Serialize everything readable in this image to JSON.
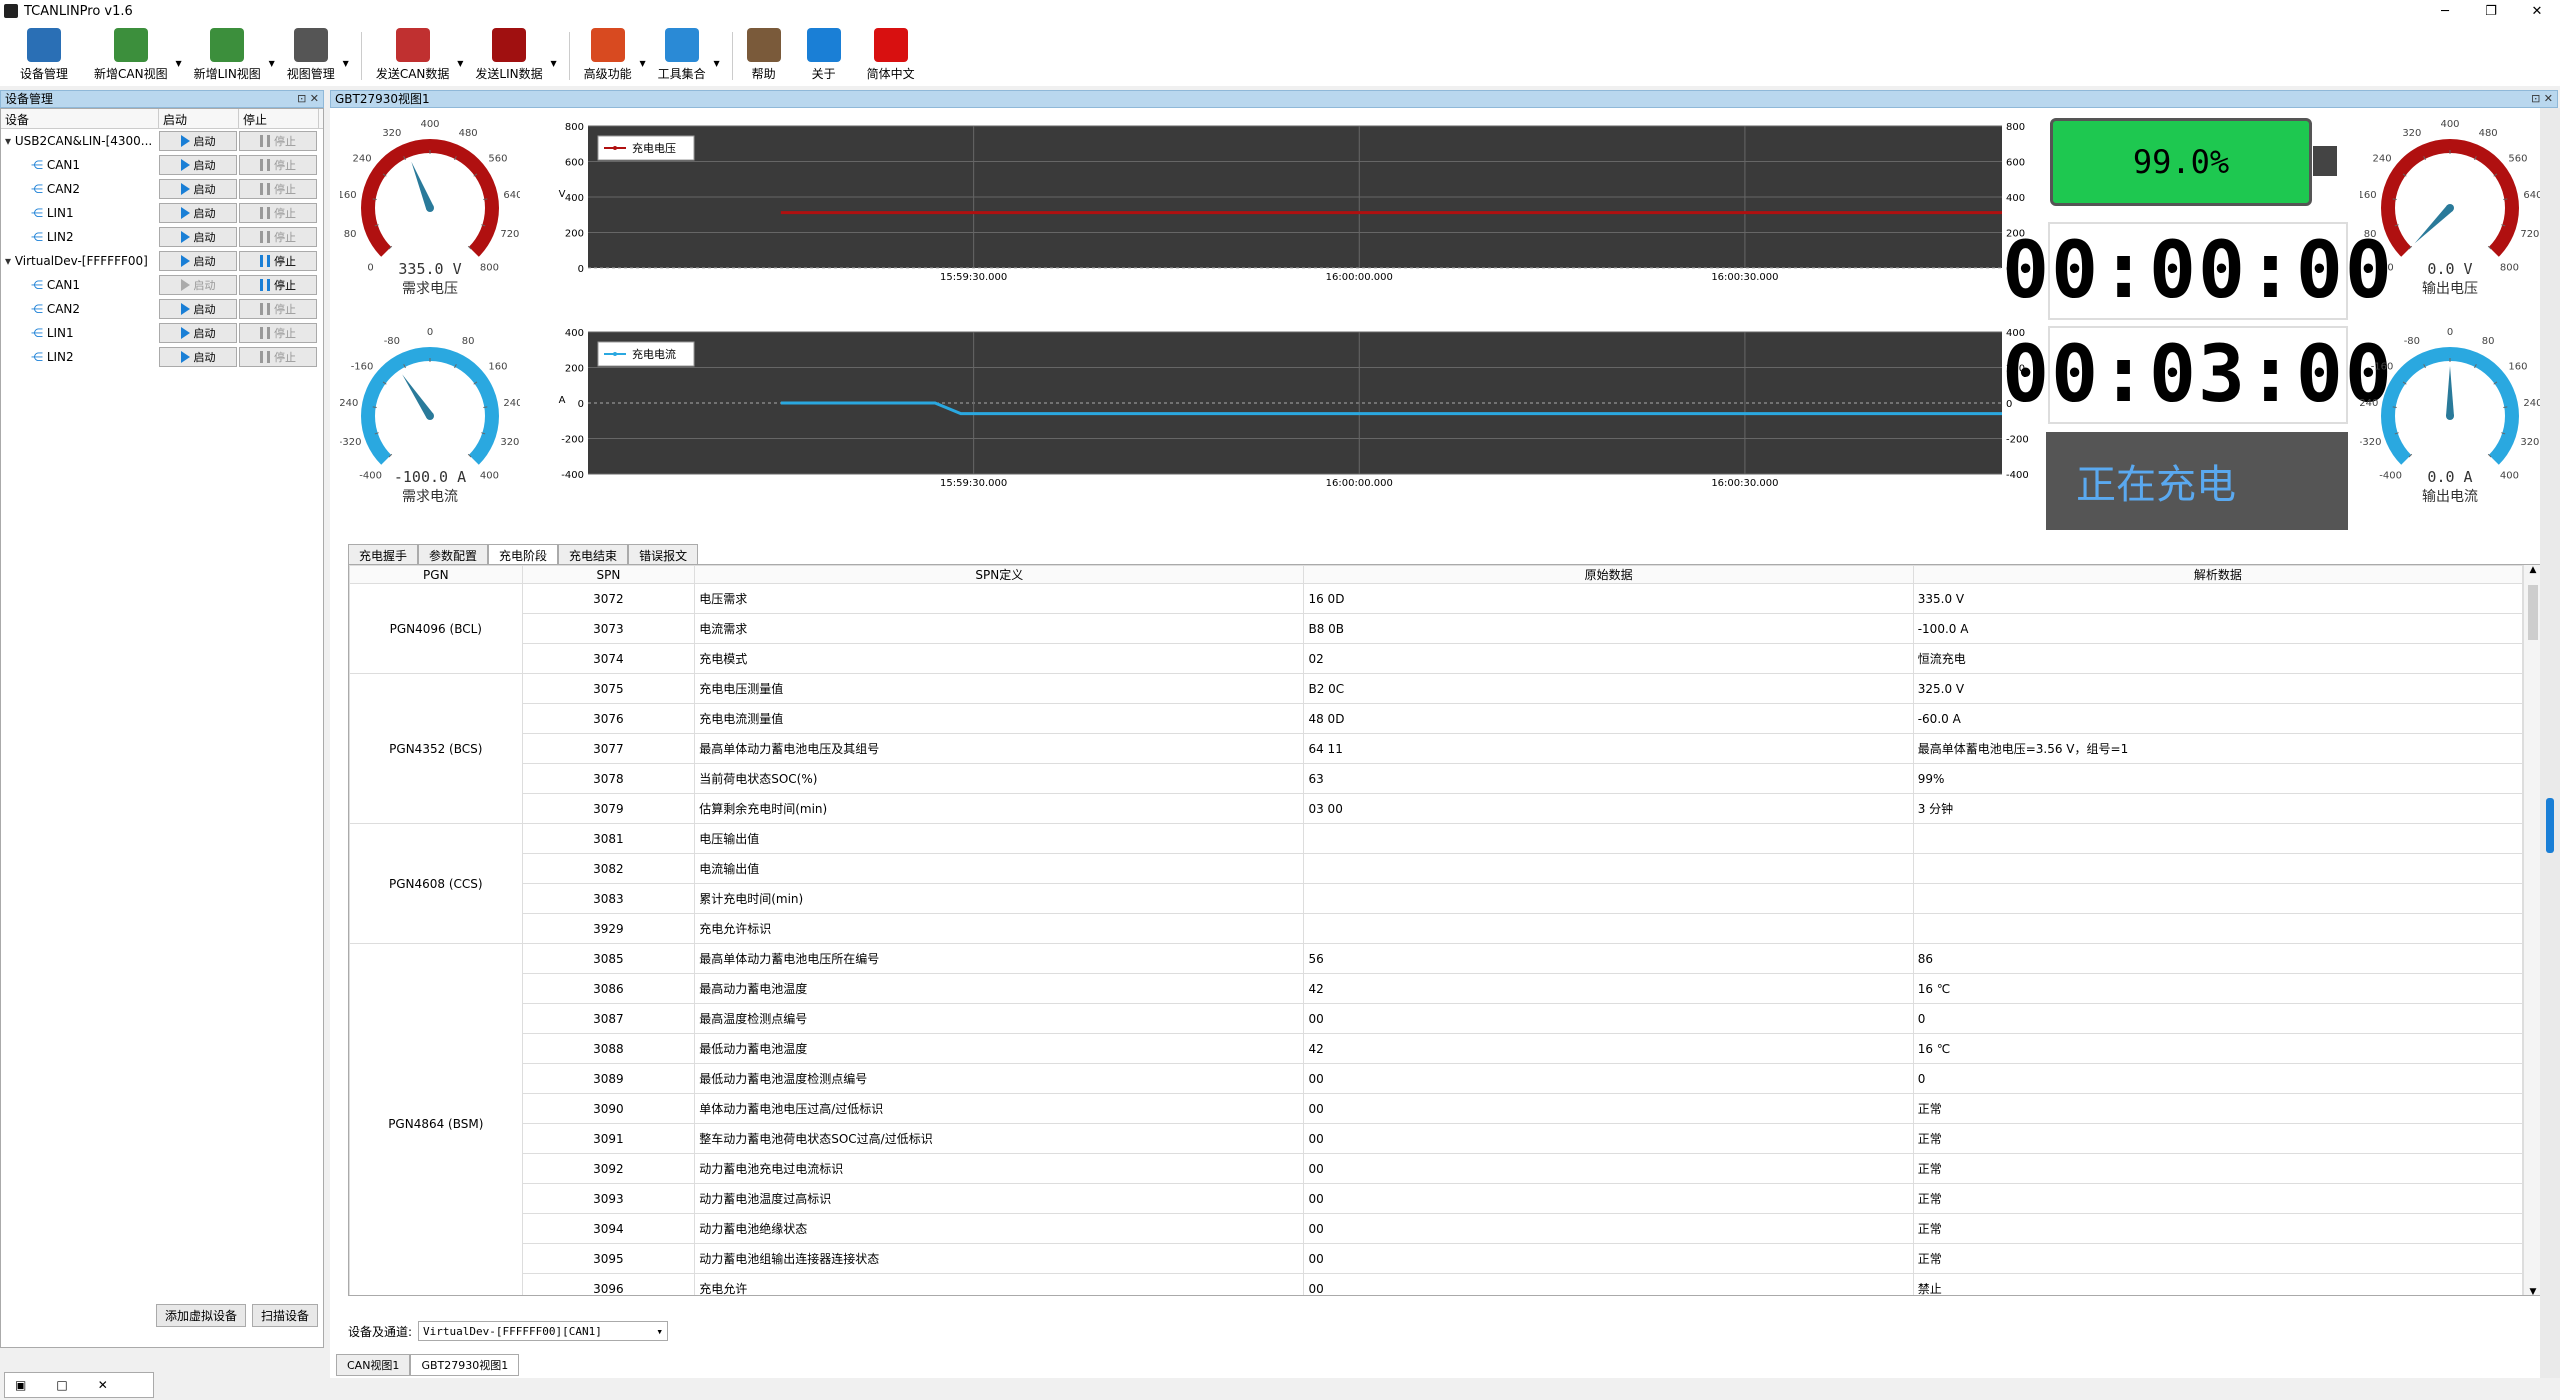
{
  "app": {
    "title": "TCANLINPro v1.6",
    "window_controls": [
      "─",
      "❐",
      "✕"
    ]
  },
  "toolbar": {
    "items": [
      {
        "label": "设备管理",
        "icon": "device-manager-icon",
        "color": "#2a6fb5",
        "dd": false
      },
      {
        "label": "新增CAN视图",
        "icon": "add-can-view-icon",
        "color": "#3c8f3c",
        "dd": true
      },
      {
        "label": "新增LIN视图",
        "icon": "add-lin-view-icon",
        "color": "#3c8f3c",
        "dd": true
      },
      {
        "label": "视图管理",
        "icon": "view-manager-icon",
        "color": "#555555",
        "dd": true
      },
      {
        "label": "发送CAN数据",
        "icon": "send-can-icon",
        "color": "#c03030",
        "dd": true
      },
      {
        "label": "发送LIN数据",
        "icon": "send-lin-icon",
        "color": "#a01010",
        "dd": true
      },
      {
        "label": "高级功能",
        "icon": "advanced-icon",
        "color": "#d84a20",
        "dd": true
      },
      {
        "label": "工具集合",
        "icon": "toolset-icon",
        "color": "#2a8ad6",
        "dd": true
      },
      {
        "label": "帮助",
        "icon": "help-icon",
        "color": "#7a5a3a",
        "dd": false
      },
      {
        "label": "关于",
        "icon": "about-icon",
        "color": "#1a7fd6",
        "dd": false
      },
      {
        "label": "简体中文",
        "icon": "china-flag-icon",
        "color": "#d81010",
        "dd": false
      }
    ]
  },
  "devpane": {
    "title": "设备管理",
    "headers": [
      "设备",
      "启动",
      "停止"
    ],
    "start_label": "启动",
    "stop_label": "停止",
    "rows": [
      {
        "name": "USB2CAN&LIN-[4300...",
        "level": 0,
        "start_enabled": true,
        "stop_active": false
      },
      {
        "name": "CAN1",
        "level": 1,
        "start_enabled": true,
        "stop_active": false
      },
      {
        "name": "CAN2",
        "level": 1,
        "start_enabled": true,
        "stop_active": false
      },
      {
        "name": "LIN1",
        "level": 1,
        "start_enabled": true,
        "stop_active": false
      },
      {
        "name": "LIN2",
        "level": 1,
        "start_enabled": true,
        "stop_active": false
      },
      {
        "name": "VirtualDev-[FFFFFF00]",
        "level": 0,
        "start_enabled": true,
        "stop_active": true
      },
      {
        "name": "CAN1",
        "level": 1,
        "start_enabled": false,
        "stop_active": true
      },
      {
        "name": "CAN2",
        "level": 1,
        "start_enabled": true,
        "stop_active": false
      },
      {
        "name": "LIN1",
        "level": 1,
        "start_enabled": true,
        "stop_active": false
      },
      {
        "name": "LIN2",
        "level": 1,
        "start_enabled": true,
        "stop_active": false
      }
    ],
    "add_virtual": "添加虚拟设备",
    "scan": "扫描设备"
  },
  "view": {
    "title": "GBT27930视图1",
    "gauges": {
      "demand_voltage": {
        "value": "335.0 V",
        "label": "需求电压",
        "ticks": [
          "0",
          "80",
          "160",
          "240",
          "320",
          "400",
          "480",
          "560",
          "640",
          "720",
          "800"
        ],
        "min": 0,
        "max": 800,
        "reading": 335,
        "color": "#b01010"
      },
      "demand_current": {
        "value": "-100.0 A",
        "label": "需求电流",
        "ticks": [
          "-400",
          "-320",
          "-240",
          "-160",
          "-80",
          "0",
          "80",
          "160",
          "240",
          "320",
          "400"
        ],
        "min": -400,
        "max": 400,
        "reading": -100,
        "color": "#2aa8e0"
      },
      "output_voltage": {
        "value": "0.0 V",
        "label": "输出电压",
        "ticks": [
          "0",
          "80",
          "160",
          "240",
          "320",
          "400",
          "480",
          "560",
          "640",
          "720",
          "800"
        ],
        "min": 0,
        "max": 800,
        "reading": 0,
        "color": "#b01010"
      },
      "output_current": {
        "value": "0.0 A",
        "label": "输出电流",
        "ticks": [
          "-400",
          "-320",
          "-240",
          "-160",
          "-80",
          "0",
          "80",
          "160",
          "240",
          "320",
          "400"
        ],
        "min": -400,
        "max": 400,
        "reading": 0,
        "color": "#2aa8e0"
      }
    },
    "battery": "99.0%",
    "timer1": "00:00:00",
    "timer2": "00:03:00",
    "status": "正在充电",
    "tabs": [
      "充电握手",
      "参数配置",
      "充电阶段",
      "充电结束",
      "错误报文"
    ],
    "selected_tab": 2,
    "table": {
      "headers": [
        "PGN",
        "SPN",
        "SPN定义",
        "原始数据",
        "解析数据"
      ],
      "groups": [
        {
          "pgn": "PGN4096 (BCL)",
          "rows": [
            [
              "3072",
              "电压需求",
              "16 0D",
              "335.0 V"
            ],
            [
              "3073",
              "电流需求",
              "B8 0B",
              "-100.0 A"
            ],
            [
              "3074",
              "充电模式",
              "02",
              "恒流充电"
            ]
          ]
        },
        {
          "pgn": "PGN4352 (BCS)",
          "rows": [
            [
              "3075",
              "充电电压测量值",
              "B2 0C",
              "325.0 V"
            ],
            [
              "3076",
              "充电电流测量值",
              "48 0D",
              "-60.0 A"
            ],
            [
              "3077",
              "最高单体动力蓄电池电压及其组号",
              "64 11",
              "最高单体蓄电池电压=3.56 V，组号=1"
            ],
            [
              "3078",
              "当前荷电状态SOC(%)",
              "63",
              "99%"
            ],
            [
              "3079",
              "估算剩余充电时间(min)",
              "03 00",
              "3 分钟"
            ]
          ]
        },
        {
          "pgn": "PGN4608 (CCS)",
          "rows": [
            [
              "3081",
              "电压输出值",
              "",
              ""
            ],
            [
              "3082",
              "电流输出值",
              "",
              ""
            ],
            [
              "3083",
              "累计充电时间(min)",
              "",
              ""
            ],
            [
              "3929",
              "充电允许标识",
              "",
              ""
            ]
          ]
        },
        {
          "pgn": "PGN4864 (BSM)",
          "rows": [
            [
              "3085",
              "最高单体动力蓄电池电压所在编号",
              "56",
              "86"
            ],
            [
              "3086",
              "最高动力蓄电池温度",
              "42",
              "16 ℃"
            ],
            [
              "3087",
              "最高温度检测点编号",
              "00",
              "0"
            ],
            [
              "3088",
              "最低动力蓄电池温度",
              "42",
              "16 ℃"
            ],
            [
              "3089",
              "最低动力蓄电池温度检测点编号",
              "00",
              "0"
            ],
            [
              "3090",
              "单体动力蓄电池电压过高/过低标识",
              "00",
              "正常"
            ],
            [
              "3091",
              "整车动力蓄电池荷电状态SOC过高/过低标识",
              "00",
              "正常"
            ],
            [
              "3092",
              "动力蓄电池充电过电流标识",
              "00",
              "正常"
            ],
            [
              "3093",
              "动力蓄电池温度过高标识",
              "00",
              "正常"
            ],
            [
              "3094",
              "动力蓄电池绝缘状态",
              "00",
              "正常"
            ],
            [
              "3095",
              "动力蓄电池组输出连接器连接状态",
              "00",
              "正常"
            ],
            [
              "3096",
              "充电允许",
              "00",
              "禁止"
            ]
          ]
        }
      ]
    },
    "device_channel_label": "设备及通道:",
    "device_channel_value": "VirtualDev-[FFFFFF00][CAN1]"
  },
  "bottom_tabs": [
    "CAN视图1",
    "GBT27930视图1"
  ],
  "chart_data": [
    {
      "type": "line",
      "series": [
        {
          "name": "充电电压",
          "color": "#b01010",
          "points": [
            [
              "15:59:15",
              312
            ],
            [
              "16:00:50",
              312
            ]
          ]
        }
      ],
      "ylabel": "V",
      "ylim": [
        0,
        800
      ],
      "yticks": [
        0,
        200,
        400,
        600,
        800
      ],
      "xticks": [
        "15:59:30.000",
        "16:00:00.000",
        "16:00:30.000"
      ],
      "xrange": [
        "15:59:00",
        "16:00:50"
      ]
    },
    {
      "type": "line",
      "series": [
        {
          "name": "充电电流",
          "color": "#2aa8e0",
          "points": [
            [
              "15:59:15",
              0
            ],
            [
              "15:59:27",
              0
            ],
            [
              "15:59:29",
              -60
            ],
            [
              "16:00:50",
              -60
            ]
          ]
        }
      ],
      "ylabel": "A",
      "ylim": [
        -400,
        400
      ],
      "yticks": [
        -400,
        -200,
        0,
        200,
        400
      ],
      "xticks": [
        "15:59:30.000",
        "16:00:00.000",
        "16:00:30.000"
      ],
      "xrange": [
        "15:59:00",
        "16:00:50"
      ]
    }
  ]
}
